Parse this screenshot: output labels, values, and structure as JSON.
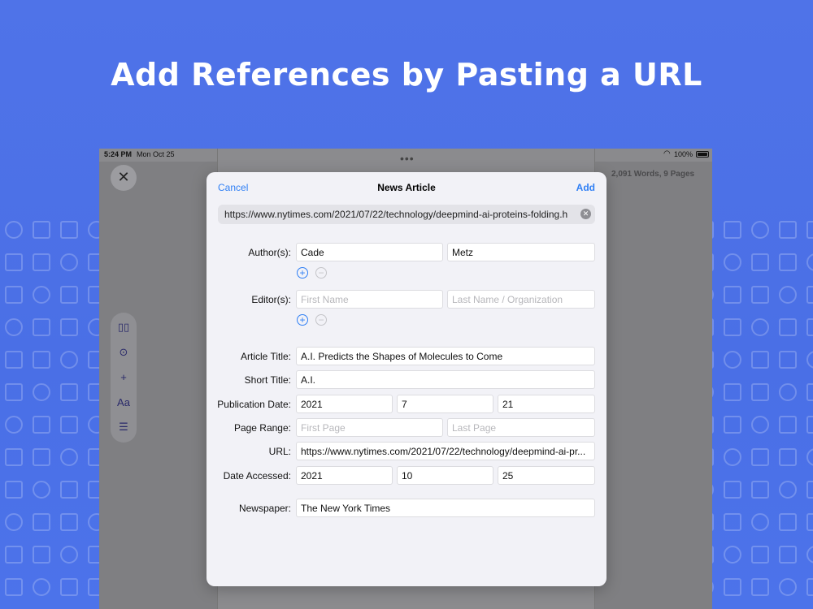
{
  "headline": "Add References by Pasting a URL",
  "status": {
    "time": "5:24 PM",
    "date": "Mon Oct 25",
    "battery": "100%"
  },
  "document": {
    "word_count": "2,091 Words, 9 Pages"
  },
  "modal": {
    "cancel": "Cancel",
    "title": "News Article",
    "add": "Add",
    "url_value": "https://www.nytimes.com/2021/07/22/technology/deepmind-ai-proteins-folding.h",
    "authors_label": "Author(s):",
    "author_first": "Cade",
    "author_last": "Metz",
    "editors_label": "Editor(s):",
    "editor_first_placeholder": "First Name",
    "editor_last_placeholder": "Last Name / Organization",
    "article_title_label": "Article Title:",
    "article_title": "A.I. Predicts the Shapes of Molecules to Come",
    "short_title_label": "Short Title:",
    "short_title": "A.I.",
    "pub_date_label": "Publication Date:",
    "pub_year": "2021",
    "pub_month": "7",
    "pub_day": "21",
    "page_range_label": "Page Range:",
    "first_page_placeholder": "First Page",
    "last_page_placeholder": "Last Page",
    "url_label": "URL:",
    "url_field": "https://www.nytimes.com/2021/07/22/technology/deepmind-ai-pr...",
    "date_accessed_label": "Date Accessed:",
    "acc_year": "2021",
    "acc_month": "10",
    "acc_day": "25",
    "newspaper_label": "Newspaper:",
    "newspaper": "The New York Times"
  },
  "colors": {
    "background": "#4f73e8",
    "accent": "#2f7ff5"
  }
}
